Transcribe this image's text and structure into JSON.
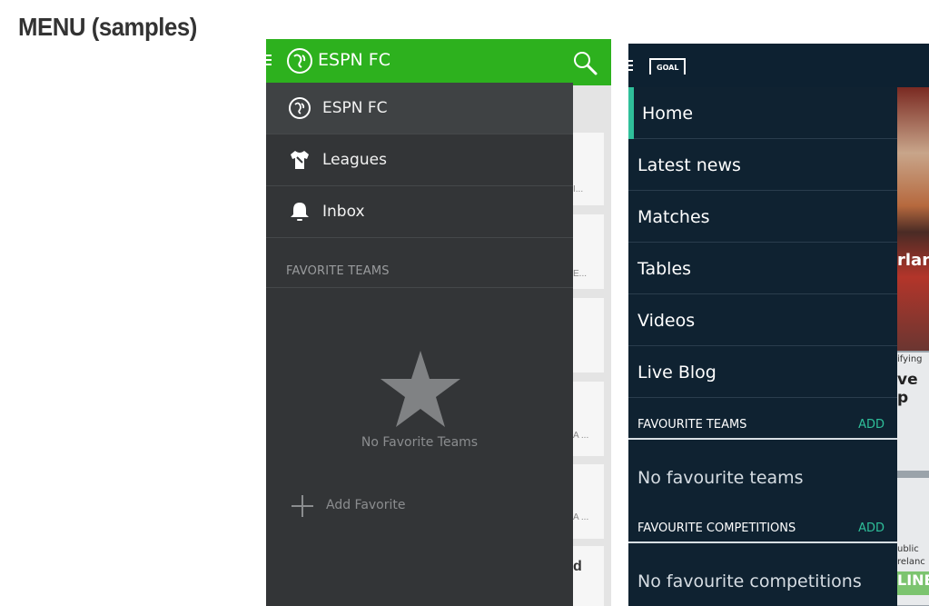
{
  "page": {
    "heading": "MENU (samples)"
  },
  "espn": {
    "app_title": "ESPN FC",
    "menu_items": [
      {
        "label": "ESPN FC",
        "icon": "espn-fc-ball-icon",
        "active": true
      },
      {
        "label": "Leagues",
        "icon": "jersey-icon",
        "active": false
      },
      {
        "label": "Inbox",
        "icon": "bell-icon",
        "active": false
      }
    ],
    "section_title": "FAVORITE TEAMS",
    "empty_text": "No Favorite Teams",
    "add_label": "Add Favorite",
    "background_snippets": [
      "I...",
      "E...",
      "A ...",
      "A ...",
      "d"
    ],
    "colors": {
      "accent": "#2db11e",
      "drawer": "#333537"
    }
  },
  "goal": {
    "logo_text": "GOAL",
    "menu_items": [
      {
        "label": "Home",
        "active": true
      },
      {
        "label": "Latest news",
        "active": false
      },
      {
        "label": "Matches",
        "active": false
      },
      {
        "label": "Tables",
        "active": false
      },
      {
        "label": "Videos",
        "active": false
      },
      {
        "label": "Live Blog",
        "active": false
      }
    ],
    "favourite_teams": {
      "title": "FAVOURITE TEAMS",
      "add": "ADD",
      "empty": "No favourite teams"
    },
    "favourite_competitions": {
      "title": "FAVOURITE COMPETITIONS",
      "add": "ADD",
      "empty": "No favourite competitions"
    },
    "background_snippets": [
      "rlan",
      "ifying",
      "ve p",
      "ublic",
      "relanc",
      "LINE"
    ],
    "colors": {
      "accent": "#2fbf9a",
      "drawer": "#0f2231"
    }
  }
}
